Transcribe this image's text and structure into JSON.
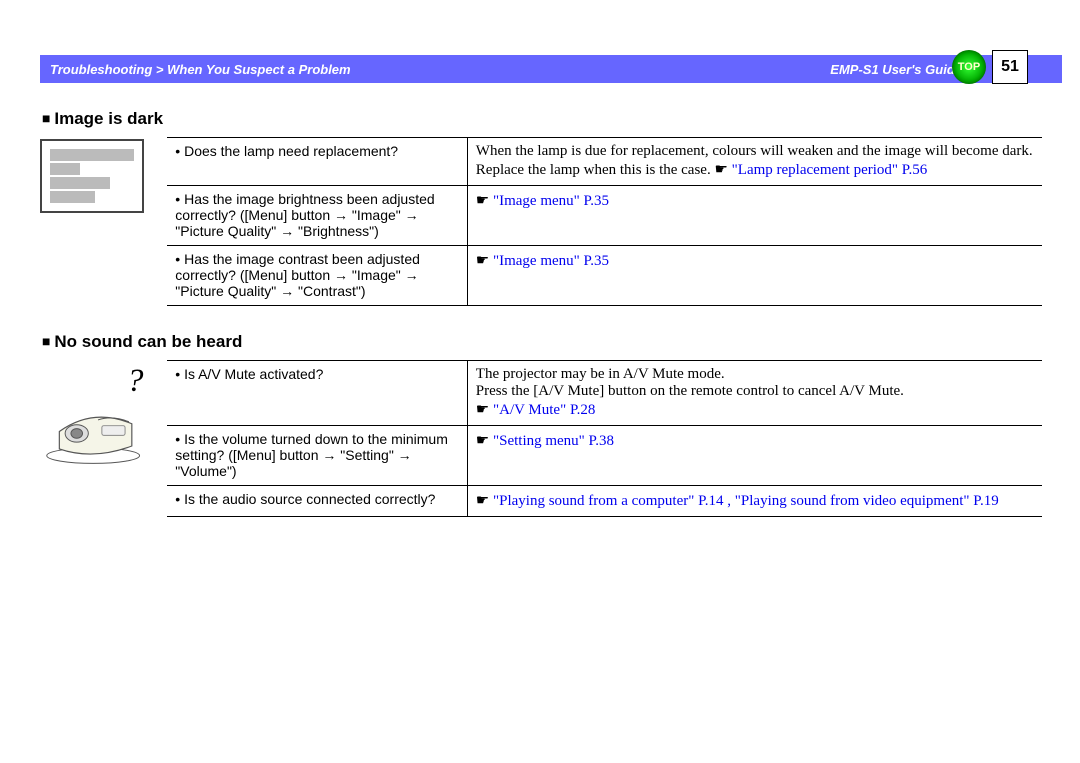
{
  "header": {
    "breadcrumb": "Troubleshooting > When You Suspect a Problem",
    "guide": "EMP-S1 User's Guide",
    "top_label": "TOP",
    "page_number": "51"
  },
  "sections": [
    {
      "title": "Image is dark",
      "icon": "bars",
      "rows": [
        {
          "q": "Does the lamp need replacement?",
          "a_plain": "When the lamp is due for replacement, colours will weaken and the image will become dark. Replace the lamp when this is the case. ",
          "a_link": "\"Lamp replacement period\" P.56"
        },
        {
          "q": "Has the image brightness been adjusted correctly? ([Menu] button → \"Image\" → \"Picture Quality\" → \"Brightness\")",
          "a_plain": "",
          "a_link": "\"Image menu\" P.35"
        },
        {
          "q": "Has the image contrast been adjusted correctly? ([Menu] button → \"Image\" → \"Picture Quality\" → \"Contrast\")",
          "a_plain": "",
          "a_link": "\"Image menu\" P.35"
        }
      ]
    },
    {
      "title": "No sound can be heard",
      "icon": "projector",
      "rows": [
        {
          "q": "Is A/V Mute activated?",
          "a_plain": "The projector may be in A/V Mute mode.\nPress the [A/V Mute] button on the remote control to cancel A/V Mute.\n",
          "a_link": "\"A/V Mute\" P.28"
        },
        {
          "q": "Is the volume turned down to the minimum setting? ([Menu] button → \"Setting\" → \"Volume\")",
          "a_plain": "",
          "a_link": "\"Setting menu\" P.38"
        },
        {
          "q": "Is the audio source connected correctly?",
          "a_plain": "",
          "a_link": "\"Playing sound from a computer\" P.14 , \"Playing sound from video equipment\" P.19"
        }
      ]
    }
  ]
}
